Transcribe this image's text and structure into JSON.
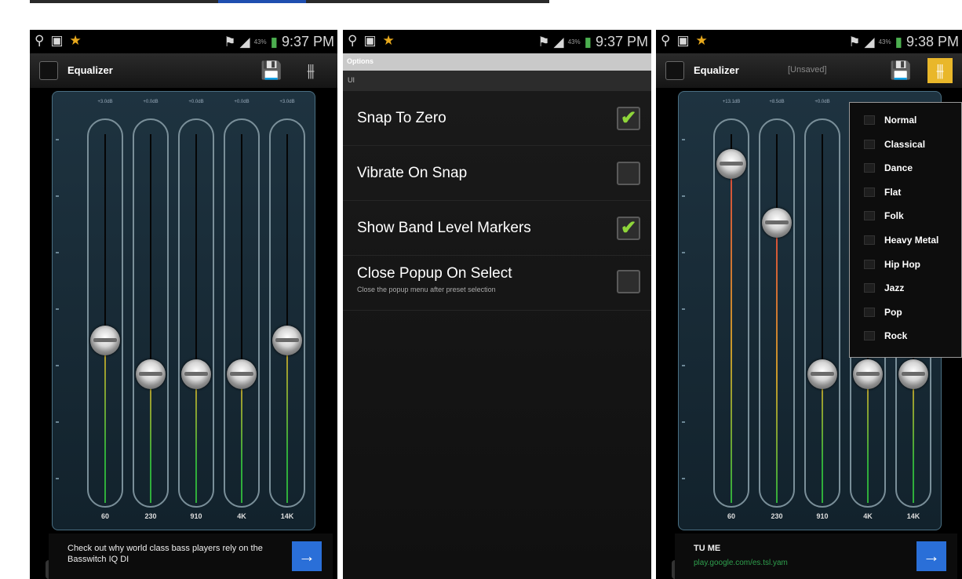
{
  "screens": [
    {
      "status": {
        "time": "9:37 PM",
        "battery": "43%"
      },
      "app_title": "Equalizer",
      "bands": [
        {
          "freq": "60",
          "db": "+3.0dB",
          "level": 0.44
        },
        {
          "freq": "230",
          "db": "+0.0dB",
          "level": 0.35
        },
        {
          "freq": "910",
          "db": "+0.0dB",
          "level": 0.35
        },
        {
          "freq": "4K",
          "db": "+0.0dB",
          "level": 0.35
        },
        {
          "freq": "14K",
          "db": "+3.0dB",
          "level": 0.44
        }
      ],
      "ad": {
        "text": "Check out why world class bass players rely on the Basswitch IQ DI",
        "button": "→"
      }
    },
    {
      "status": {
        "time": "9:37 PM",
        "battery": "43%"
      },
      "header": "Options",
      "section": "UI",
      "options": [
        {
          "label": "Snap To Zero",
          "desc": "",
          "checked": true
        },
        {
          "label": "Vibrate On Snap",
          "desc": "",
          "checked": false
        },
        {
          "label": "Show Band Level Markers",
          "desc": "",
          "checked": true
        },
        {
          "label": "Close Popup On Select",
          "desc": "Close the popup menu after preset selection",
          "checked": false
        }
      ]
    },
    {
      "status": {
        "time": "9:38 PM",
        "battery": "43%"
      },
      "app_title": "Equalizer",
      "unsaved": "[Unsaved]",
      "bands": [
        {
          "freq": "60",
          "db": "+13.1dB",
          "level": 0.92
        },
        {
          "freq": "230",
          "db": "+8.5dB",
          "level": 0.76
        },
        {
          "freq": "910",
          "db": "+0.0dB",
          "level": 0.35
        },
        {
          "freq": "4K",
          "db": "",
          "level": 0.35
        },
        {
          "freq": "14K",
          "db": "",
          "level": 0.35
        }
      ],
      "presets": [
        "Normal",
        "Classical",
        "Dance",
        "Flat",
        "Folk",
        "Heavy Metal",
        "Hip Hop",
        "Jazz",
        "Pop",
        "Rock"
      ],
      "ad": {
        "title": "TU ME",
        "url": "play.google.com/es.tsl.yam",
        "button": "→"
      }
    }
  ],
  "colors": {
    "accent": "#e9b72a",
    "ad_button": "#2a6fd8",
    "check": "#8fd63a",
    "level_high": "#d84a3a",
    "level_mid": "#c99a2a",
    "level_low": "#2fae3b"
  }
}
